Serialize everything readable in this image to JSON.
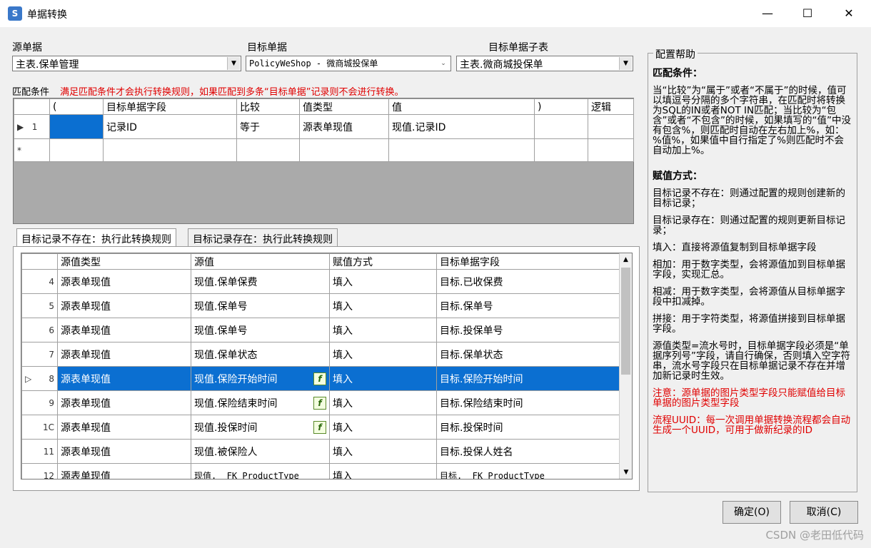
{
  "window": {
    "title": "单据转换",
    "icon_label": "S"
  },
  "source": {
    "label": "源单据",
    "value": "主表.保单管理"
  },
  "target": {
    "label": "目标单据",
    "value": "PolicyWeShop - 微商城投保单"
  },
  "target_sub": {
    "label": "目标单据子表",
    "value": "主表.微商城投保单"
  },
  "match": {
    "label": "匹配条件",
    "hint": "满足匹配条件才会执行转换规则，如果匹配到多条“目标单据”记录则不会进行转换。",
    "columns": [
      "(",
      "目标单据字段",
      "比较",
      "值类型",
      "值",
      ")",
      "逻辑"
    ],
    "rows": [
      {
        "num": "1",
        "cells": [
          "",
          "记录ID",
          "等于",
          "源表单现值",
          "现值.记录ID",
          "",
          ""
        ]
      }
    ],
    "new_row_marker": "*"
  },
  "tabs": [
    {
      "label": "目标记录不存在：执行此转换规则"
    },
    {
      "label": "目标记录存在：执行此转换规则"
    }
  ],
  "rules": {
    "columns": [
      "源值类型",
      "源值",
      "赋值方式",
      "目标单据字段"
    ],
    "rows": [
      {
        "num": "4",
        "cells": [
          "源表单现值",
          "现值.保单保费",
          "填入",
          "目标.已收保费"
        ],
        "fx": false
      },
      {
        "num": "5",
        "cells": [
          "源表单现值",
          "现值.保单号",
          "填入",
          "目标.保单号"
        ],
        "fx": false
      },
      {
        "num": "6",
        "cells": [
          "源表单现值",
          "现值.保单号",
          "填入",
          "目标.投保单号"
        ],
        "fx": false
      },
      {
        "num": "7",
        "cells": [
          "源表单现值",
          "现值.保单状态",
          "填入",
          "目标.保单状态"
        ],
        "fx": false
      },
      {
        "num": "8",
        "cells": [
          "源表单现值",
          "现值.保险开始时间",
          "填入",
          "目标.保险开始时间"
        ],
        "fx": true,
        "selected": true
      },
      {
        "num": "9",
        "cells": [
          "源表单现值",
          "现值.保险结束时间",
          "填入",
          "目标.保险结束时间"
        ],
        "fx": true
      },
      {
        "num": "1C",
        "cells": [
          "源表单现值",
          "现值.投保时间",
          "填入",
          "目标.投保时间"
        ],
        "fx": true
      },
      {
        "num": "11",
        "cells": [
          "源表单现值",
          "现值.被保险人",
          "填入",
          "目标.投保人姓名"
        ],
        "fx": false
      },
      {
        "num": "12",
        "cells": [
          "源表单现值",
          "现值.__FK_ProductType_",
          "填入",
          "目标.__FK_ProductType_"
        ],
        "fx": false
      }
    ],
    "fx_label": "f"
  },
  "help": {
    "legend": "配置帮助",
    "h1": "匹配条件：",
    "p1": "当“比较”为“属于”或者“不属于”的时候，值可以填逗号分隔的多个字符串，在匹配时将转换为SQL的IN或者NOT IN匹配；当比较为“包含”或者“不包含”的时候，如果填写的“值”中没有包含%，则匹配时自动在左右加上%，如：%值%，如果值中自行指定了%则匹配时不会自动加上%。",
    "h2": "赋值方式：",
    "p2": "目标记录不存在：则通过配置的规则创建新的目标记录；",
    "p3": "目标记录存在：则通过配置的规则更新目标记录；",
    "p4": "填入：直接将源值复制到目标单据字段",
    "p5": "相加：用于数字类型，会将源值加到目标单据字段，实现汇总。",
    "p6": "相减：用于数字类型，会将源值从目标单据字段中扣减掉。",
    "p7": "拼接：用于字符类型，将源值拼接到目标单据字段。",
    "p8": "源值类型=流水号时，目标单据字段必须是“单据序列号”字段，请自行确保，否则填入空字符串，流水号字段只在目标单据记录不存在并增加新记录时生效。",
    "p9": "注意：源单据的图片类型字段只能赋值给目标单据的图片类型字段",
    "p10": "流程UUID：每一次调用单据转换流程都会自动生成一个UUID，可用于做新纪录的ID"
  },
  "buttons": {
    "ok": "确定(O)",
    "cancel": "取消(C)"
  },
  "watermark": "CSDN @老田低代码"
}
